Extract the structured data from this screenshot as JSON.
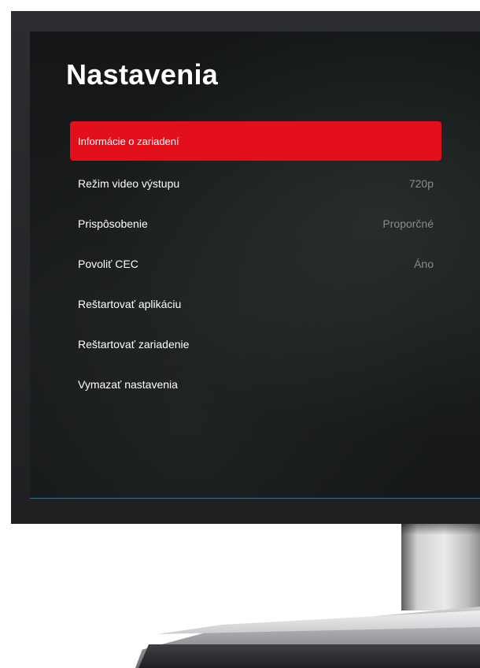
{
  "settings": {
    "title": "Nastavenia",
    "items": [
      {
        "label": "Informácie o zariadení",
        "value": "",
        "selected": true
      },
      {
        "label": "Režim video výstupu",
        "value": "720p"
      },
      {
        "label": "Prispôsobenie",
        "value": "Proporčné"
      },
      {
        "label": "Povoliť CEC",
        "value": "Áno"
      },
      {
        "label": "Reštartovať aplikáciu",
        "value": ""
      },
      {
        "label": "Reštartovať zariadenie",
        "value": ""
      },
      {
        "label": "Vymazať nastavenia",
        "value": ""
      }
    ]
  },
  "colors": {
    "accent": "#e3101c",
    "background": "#141617",
    "text": "#ffffff",
    "muted_value": "#8a8c8e"
  }
}
